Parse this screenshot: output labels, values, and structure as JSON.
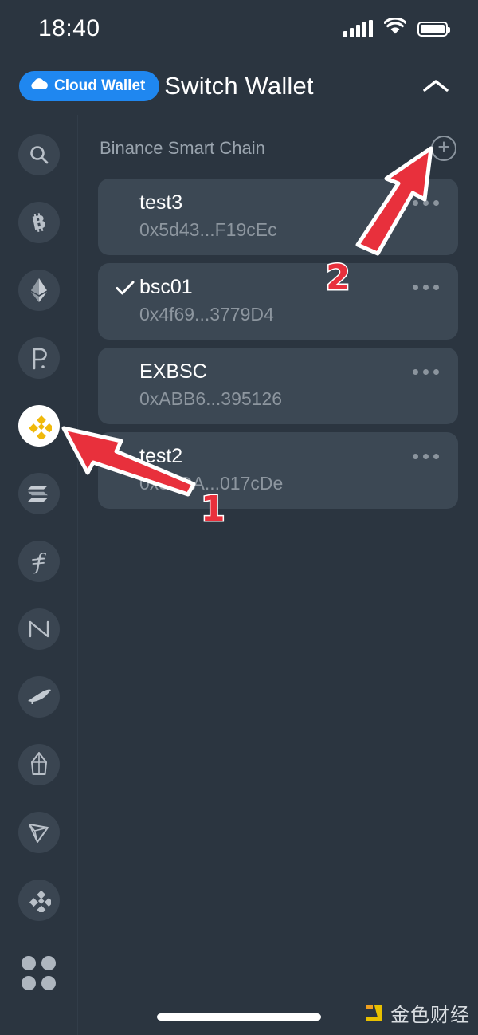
{
  "status_bar": {
    "time": "18:40",
    "signal_icon": "signal-bars-icon",
    "wifi_icon": "wifi-icon",
    "battery_icon": "battery-icon"
  },
  "header": {
    "cloud_badge": "Cloud Wallet",
    "cloud_icon": "cloud-icon",
    "title": "Switch Wallet",
    "collapse_icon": "chevron-up-icon"
  },
  "sidebar": {
    "items": [
      {
        "name": "search",
        "icon": "search-icon",
        "active": false
      },
      {
        "name": "bitcoin",
        "icon": "bitcoin-icon",
        "active": false
      },
      {
        "name": "ethereum",
        "icon": "ethereum-icon",
        "active": false
      },
      {
        "name": "polkadot",
        "icon": "polkadot-icon",
        "active": false
      },
      {
        "name": "binance-smart-chain",
        "icon": "bnb-icon",
        "active": true
      },
      {
        "name": "solana",
        "icon": "solana-icon",
        "active": false
      },
      {
        "name": "filecoin",
        "icon": "filecoin-icon",
        "active": false
      },
      {
        "name": "near",
        "icon": "near-icon",
        "active": false
      },
      {
        "name": "kusama",
        "icon": "kusama-bird-icon",
        "active": false
      },
      {
        "name": "eos",
        "icon": "eos-icon",
        "active": false
      },
      {
        "name": "tron",
        "icon": "tron-icon",
        "active": false
      },
      {
        "name": "binance-chain",
        "icon": "binance-chain-icon",
        "active": false
      }
    ],
    "more_icon": "grid-dots-icon"
  },
  "main": {
    "chain_label": "Binance Smart Chain",
    "add_icon": "plus-circle-icon",
    "wallets": [
      {
        "name": "test3",
        "address": "0x5d43...F19cEc",
        "selected": false,
        "menu_icon": "more-dots-icon"
      },
      {
        "name": "bsc01",
        "address": "0x4f69...3779D4",
        "selected": true,
        "menu_icon": "more-dots-icon"
      },
      {
        "name": "EXBSC",
        "address": "0xABB6...395126",
        "selected": false,
        "menu_icon": "more-dots-icon"
      },
      {
        "name": "test2",
        "address": "0x55DA...017cDe",
        "selected": false,
        "menu_icon": "more-dots-icon"
      }
    ]
  },
  "annotations": [
    {
      "label": "1",
      "points_to": "sidebar-item-binance-smart-chain"
    },
    {
      "label": "2",
      "points_to": "add-wallet-button"
    }
  ],
  "watermark": {
    "text": "金色财经",
    "logo_icon": "jinse-logo-icon"
  },
  "colors": {
    "background": "#2b3540",
    "card": "#3c4854",
    "accent_blue": "#1f87f0",
    "accent_gold": "#f0b90b",
    "annotation_red": "#e8303c",
    "muted_text": "#8d969f"
  }
}
